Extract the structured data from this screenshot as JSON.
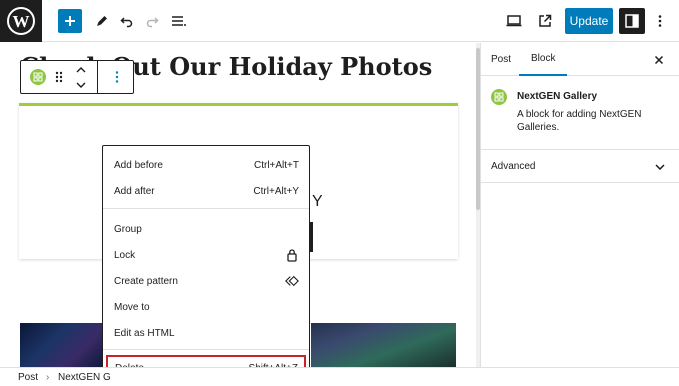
{
  "toolbar": {
    "update_label": "Update"
  },
  "editor": {
    "post_title": "Check Out Our Holiday Photos",
    "block_fragment": "Y"
  },
  "menu": {
    "items": [
      {
        "label": "Add before",
        "shortcut": "Ctrl+Alt+T"
      },
      {
        "label": "Add after",
        "shortcut": "Ctrl+Alt+Y"
      },
      {
        "label": "Group",
        "shortcut": ""
      },
      {
        "label": "Lock",
        "shortcut": "",
        "icon": "lock-icon"
      },
      {
        "label": "Create pattern",
        "shortcut": "",
        "icon": "pattern-icon"
      },
      {
        "label": "Move to",
        "shortcut": ""
      },
      {
        "label": "Edit as HTML",
        "shortcut": ""
      },
      {
        "label": "Delete",
        "shortcut": "Shift+Alt+Z",
        "highlighted": true
      }
    ]
  },
  "breadcrumb": {
    "post": "Post",
    "block": "NextGEN G"
  },
  "sidebar": {
    "tabs": [
      {
        "label": "Post",
        "active": false
      },
      {
        "label": "Block",
        "active": true
      }
    ],
    "block_title": "NextGEN Gallery",
    "block_description": "A block for adding NextGEN Galleries.",
    "advanced_label": "Advanced"
  },
  "colors": {
    "accent": "#007cba",
    "gallery_icon": "#8ec641",
    "block_border": "#9fce3c",
    "delete_highlight": "#c8232c",
    "dark": "#1e1e1e"
  }
}
